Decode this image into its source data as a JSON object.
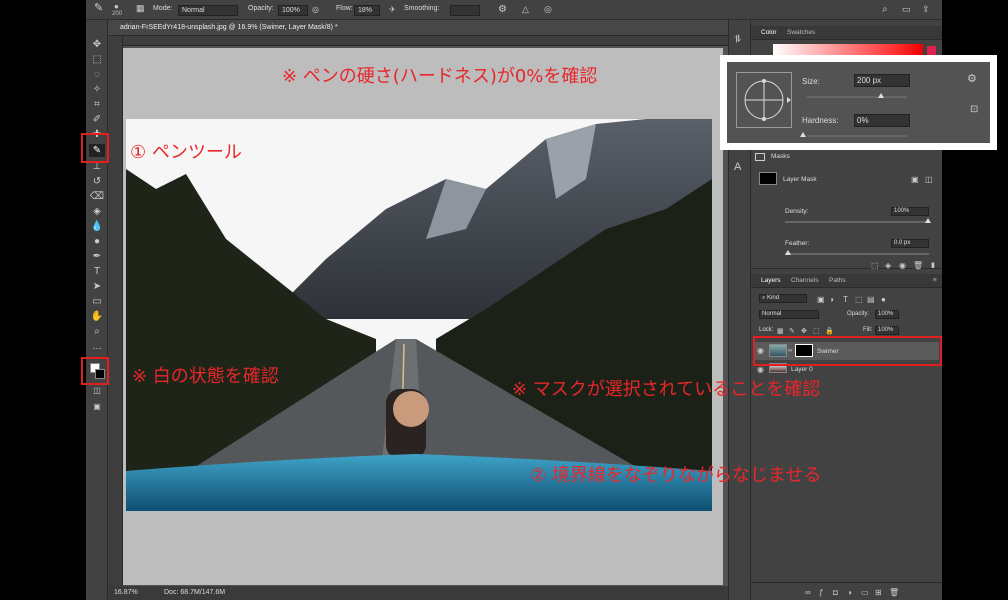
{
  "options_bar": {
    "brush_size": "200",
    "mode_label": "Mode:",
    "mode_value": "Normal",
    "opacity_label": "Opacity:",
    "opacity_value": "100%",
    "flow_label": "Flow:",
    "flow_value": "18%",
    "smoothing_label": "Smoothing:"
  },
  "document": {
    "tab_title": "adrian-FrSEEdYr418-unsplash.jpg @ 16.9% (Swimer, Layer Mask/8) *"
  },
  "status_bar": {
    "zoom": "16.87%",
    "doc_info": "Doc: 68.7M/147.6M"
  },
  "color_panel": {
    "tab_color": "Color",
    "tab_swatches": "Swatches"
  },
  "brush_popup": {
    "size_label": "Size:",
    "size_value": "200 px",
    "hardness_label": "Hardness:",
    "hardness_value": "0%"
  },
  "properties_panel": {
    "masks_label": "Masks",
    "layer_mask_label": "Layer Mask",
    "density_label": "Density:",
    "density_value": "100%",
    "feather_label": "Feather:",
    "feather_value": "0.0 px"
  },
  "layers_panel": {
    "tabs": [
      "Layers",
      "Channels",
      "Paths"
    ],
    "kind_filter": "Kind",
    "blend_mode": "Normal",
    "opacity_label": "Opacity:",
    "opacity_value": "100%",
    "lock_label": "Lock:",
    "fill_label": "Fill:",
    "fill_value": "100%",
    "layers": [
      {
        "name": "Swimer",
        "selected": true
      },
      {
        "name": "Layer 0",
        "selected": false
      }
    ]
  },
  "annotations": {
    "hardness_note": "※ ペンの硬さ(ハードネス)が0%を確認",
    "pen_tool_note": "① ペンツール",
    "white_note": "※ 白の状態を確認",
    "mask_note": "※ マスクが選択されていることを確認",
    "blend_note": "② 境界線をなぞりながらなじませる"
  },
  "colors": {
    "annotation_red": "#e8272a",
    "panel_bg": "#424242",
    "canvas_bg": "#535353"
  }
}
